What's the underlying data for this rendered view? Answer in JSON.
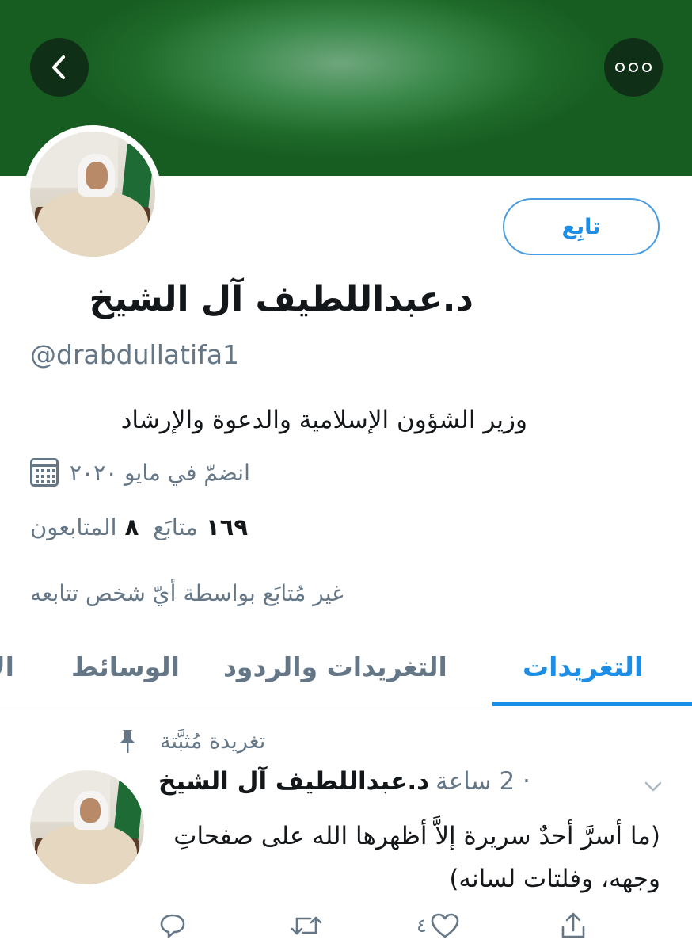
{
  "profile": {
    "name": "د.عبداللطيف آل الشيخ",
    "handle": "@drabdullatifa1",
    "bio": "وزير الشؤون الإسلامية والدعوة والإرشاد",
    "joined": "انضمّ في مايو ٢٠٢٠",
    "following_count": "١٦٩",
    "following_label": "متابَع",
    "followers_count": "٨",
    "followers_label": "المتابعون",
    "not_followed_text": "غير مُتابَع بواسطة أيّ شخص تتابعه",
    "follow_button": "تابِع"
  },
  "tabs": [
    {
      "label": "التغريدات",
      "active": true
    },
    {
      "label": "التغريدات والردود",
      "active": false
    },
    {
      "label": "الوسائط",
      "active": false
    },
    {
      "label": "الإعجابات",
      "active": false
    }
  ],
  "pinned_tweet": {
    "pinned_label": "تغريدة مُثبَّتة",
    "author_name": "د.عبداللطيف آل الشيخ",
    "meta": "· 2 ساعة",
    "text": "(ما أسرَّ أحدٌ سريرة إلاَّ أظهرها الله على صفحاتِ وجهه، وفلتات لسانه)",
    "like_count": "٤"
  },
  "icons": {
    "back": "back-arrow-icon",
    "more": "more-icon",
    "calendar": "calendar-icon",
    "pin": "pin-icon",
    "chevron": "chevron-down-icon",
    "reply": "reply-icon",
    "retweet": "retweet-icon",
    "like": "heart-icon",
    "share": "share-icon"
  },
  "colors": {
    "accent": "#1d8ee6",
    "banner": "#2c7a3a",
    "muted": "#657786"
  }
}
